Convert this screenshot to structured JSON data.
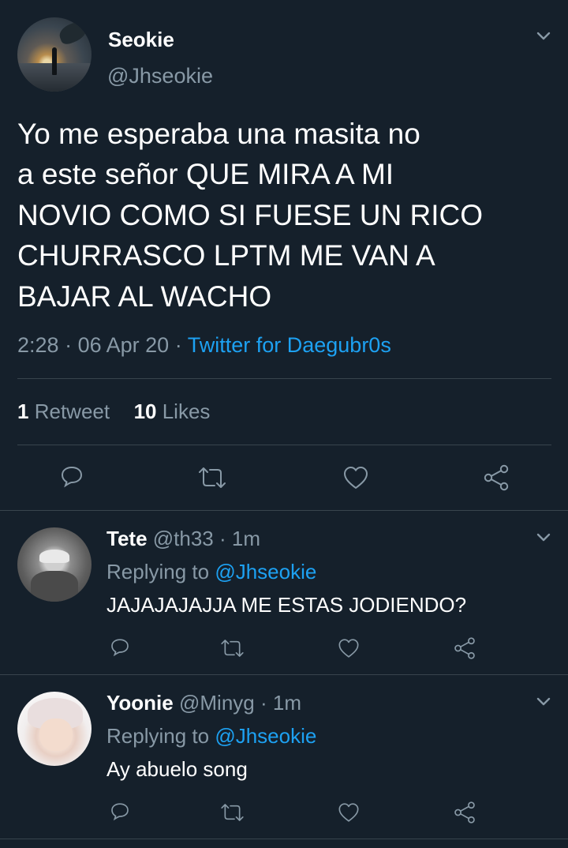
{
  "main_tweet": {
    "display_name": "Seokie",
    "handle": "@Jhseokie",
    "text": "Yo me esperaba una masita no\na este señor QUE MIRA A MI\nNOVIO COMO SI FUESE UN RICO\nCHURRASCO LPTM ME VAN A\nBAJAR AL WACHO",
    "time": "2:28",
    "date": "06 Apr 20",
    "source": "Twitter for Daegubr0s",
    "separator": "·",
    "retweets_count": "1",
    "retweets_label": "Retweet",
    "likes_count": "10",
    "likes_label": "Likes"
  },
  "replies": [
    {
      "display_name": "Tete",
      "handle": "@th33",
      "time": "1m",
      "replying_label": "Replying to",
      "replying_to": "@Jhseokie",
      "text": "JAJAJAJAJJA ME ESTAS JODIENDO?"
    },
    {
      "display_name": "Yoonie",
      "handle": "@Minyg",
      "time": "1m",
      "replying_label": "Replying to",
      "replying_to": "@Jhseokie",
      "text": "Ay abuelo song"
    }
  ],
  "icons": {
    "reply": "reply-icon",
    "retweet": "retweet-icon",
    "like": "heart-icon",
    "share": "share-icon",
    "more": "chevron-down-icon"
  },
  "colors": {
    "background": "#15202b",
    "text": "#ffffff",
    "muted": "#8899a6",
    "link": "#1da1f2",
    "divider": "#38444d"
  }
}
